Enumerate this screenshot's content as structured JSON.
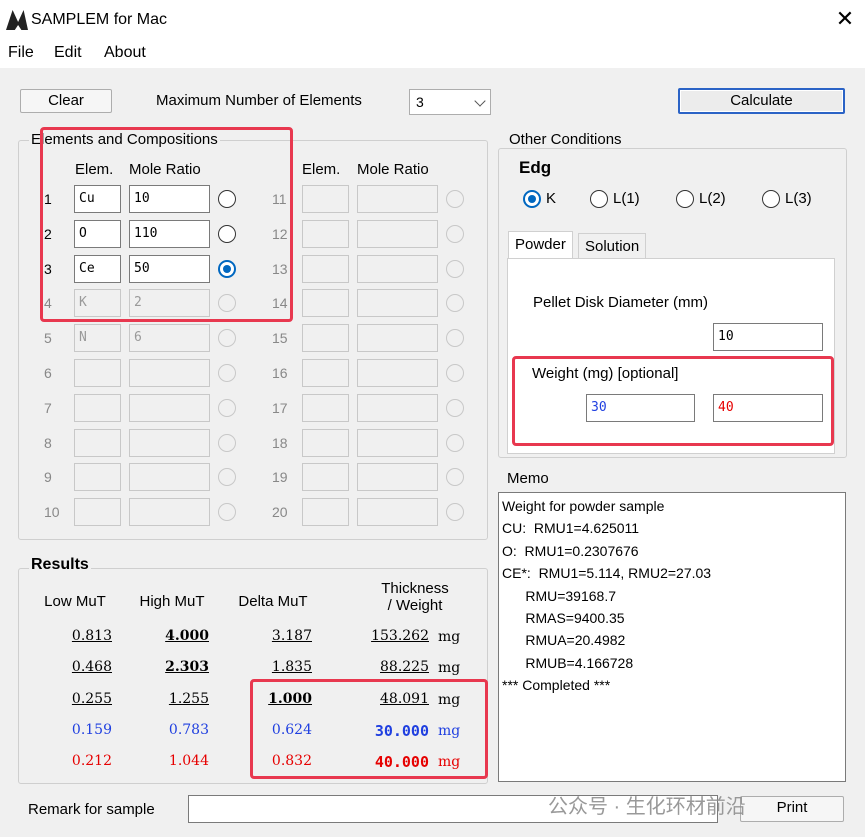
{
  "window": {
    "title": "SAMPLEM for Mac",
    "close_glyph": "✕"
  },
  "menu": {
    "file": "File",
    "edit": "Edit",
    "about": "About"
  },
  "toolbar": {
    "clear_label": "Clear",
    "max_elements_label": "Maximum Number of Elements",
    "max_elements_value": "3",
    "calculate_label": "Calculate"
  },
  "elements": {
    "group_label": "Elements and Compositions",
    "col_elem": "Elem.",
    "col_ratio": "Mole Ratio",
    "left_rows": [
      {
        "idx": "1",
        "elem": "Cu",
        "ratio": "10",
        "state": "active",
        "selected": false
      },
      {
        "idx": "2",
        "elem": "O",
        "ratio": "110",
        "state": "active",
        "selected": false
      },
      {
        "idx": "3",
        "elem": "Ce",
        "ratio": "50",
        "state": "active",
        "selected": true
      },
      {
        "idx": "4",
        "elem": "K",
        "ratio": "2",
        "state": "disabled",
        "selected": false
      },
      {
        "idx": "5",
        "elem": "N",
        "ratio": "6",
        "state": "disabled",
        "selected": false
      },
      {
        "idx": "6",
        "elem": "",
        "ratio": "",
        "state": "disabled",
        "selected": false
      },
      {
        "idx": "7",
        "elem": "",
        "ratio": "",
        "state": "disabled",
        "selected": false
      },
      {
        "idx": "8",
        "elem": "",
        "ratio": "",
        "state": "disabled",
        "selected": false
      },
      {
        "idx": "9",
        "elem": "",
        "ratio": "",
        "state": "disabled",
        "selected": false
      },
      {
        "idx": "10",
        "elem": "",
        "ratio": "",
        "state": "disabled",
        "selected": false
      }
    ],
    "right_rows": [
      {
        "idx": "11",
        "elem": "",
        "ratio": ""
      },
      {
        "idx": "12",
        "elem": "",
        "ratio": ""
      },
      {
        "idx": "13",
        "elem": "",
        "ratio": ""
      },
      {
        "idx": "14",
        "elem": "",
        "ratio": ""
      },
      {
        "idx": "15",
        "elem": "",
        "ratio": ""
      },
      {
        "idx": "16",
        "elem": "",
        "ratio": ""
      },
      {
        "idx": "17",
        "elem": "",
        "ratio": ""
      },
      {
        "idx": "18",
        "elem": "",
        "ratio": ""
      },
      {
        "idx": "19",
        "elem": "",
        "ratio": ""
      },
      {
        "idx": "20",
        "elem": "",
        "ratio": ""
      }
    ]
  },
  "other": {
    "group_label": "Other Conditions",
    "edge_label": "Edg",
    "edges": [
      {
        "label": "K",
        "checked": true
      },
      {
        "label": "L(1)",
        "checked": false
      },
      {
        "label": "L(2)",
        "checked": false
      },
      {
        "label": "L(3)",
        "checked": false
      }
    ],
    "tabs": {
      "powder": "Powder",
      "solution": "Solution"
    },
    "pellet_label": "Pellet Disk Diameter (mm)",
    "pellet_value": "10",
    "weight_label": "Weight (mg) [optional]",
    "weight_blue": "30",
    "weight_red": "40",
    "accent_blue": "#1f3fe0",
    "accent_red": "#e60000",
    "highlight": "#e8384f"
  },
  "memo": {
    "label": "Memo",
    "lines": [
      "Weight for powder sample",
      "CU:  RMU1=4.625011",
      "O:  RMU1=0.2307676",
      "CE*:  RMU1=5.114, RMU2=27.03",
      "      RMU=39168.7",
      "      RMAS=9400.35",
      "      RMUA=20.4982",
      "      RMUB=4.166728",
      "*** Completed ***"
    ]
  },
  "results": {
    "label": "Results",
    "headers": {
      "low": "Low MuT",
      "high": "High MuT",
      "delta": "Delta MuT",
      "thick1": "Thickness",
      "thick2": "/ Weight"
    },
    "unit": "mg",
    "rows": [
      {
        "low": "0.813",
        "high": "4.000",
        "delta": "3.187",
        "thick": "153.262",
        "style": "black",
        "bold_col": "high"
      },
      {
        "low": "0.468",
        "high": "2.303",
        "delta": "1.835",
        "thick": "88.225",
        "style": "black",
        "bold_col": "high"
      },
      {
        "low": "0.255",
        "high": "1.255",
        "delta": "1.000",
        "thick": "48.091",
        "style": "black",
        "bold_col": "delta"
      },
      {
        "low": "0.159",
        "high": "0.783",
        "delta": "0.624",
        "thick": "30.000",
        "style": "blue",
        "bold_col": "thick"
      },
      {
        "low": "0.212",
        "high": "1.044",
        "delta": "0.832",
        "thick": "40.000",
        "style": "red",
        "bold_col": "thick"
      }
    ]
  },
  "footer": {
    "remark_label": "Remark for sample",
    "remark_value": "",
    "print_label": "Print"
  },
  "watermark": "公众号 · 生化环材前沿"
}
